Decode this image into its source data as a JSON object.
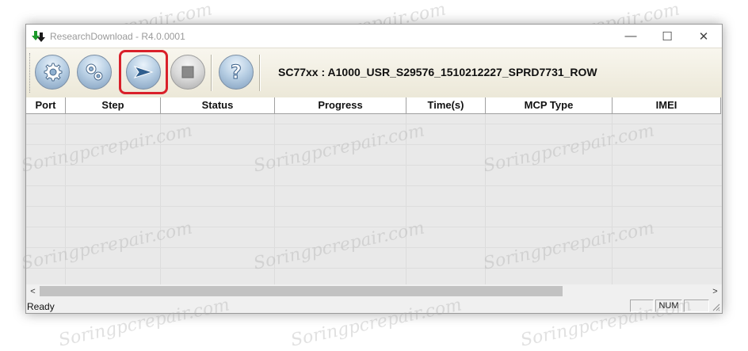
{
  "window": {
    "title": "ResearchDownload - R4.0.0001",
    "controls": {
      "minimize": "—",
      "maximize": "☐",
      "close": "✕"
    }
  },
  "toolbar": {
    "buttons": [
      {
        "name": "load-packet-button",
        "icon": "gear-icon",
        "style": "blue"
      },
      {
        "name": "settings-button",
        "icon": "gears-icon",
        "style": "blue"
      },
      {
        "name": "start-download-button",
        "icon": "play-arrow-icon",
        "style": "blue",
        "highlighted": true
      },
      {
        "name": "stop-download-button",
        "icon": "stop-icon",
        "style": "gray"
      },
      {
        "name": "help-button",
        "icon": "question-icon",
        "style": "blue"
      }
    ],
    "device_label": "SC77xx : A1000_USR_S29576_1510212227_SPRD7731_ROW"
  },
  "grid": {
    "columns": [
      "Port",
      "Step",
      "Status",
      "Progress",
      "Time(s)",
      "MCP Type",
      "IMEI"
    ],
    "rows": []
  },
  "scrollbar": {
    "left_arrow": "<",
    "right_arrow": ">"
  },
  "statusbar": {
    "text": "Ready",
    "panels": [
      "",
      "NUM",
      ""
    ]
  },
  "watermark": "Soringpcrepair.com",
  "colors": {
    "highlight": "#d9202a",
    "grid_bg": "#e9e9e9",
    "toolbar_bg": "#ece8d8",
    "button_blue": "#7f9dbd"
  }
}
